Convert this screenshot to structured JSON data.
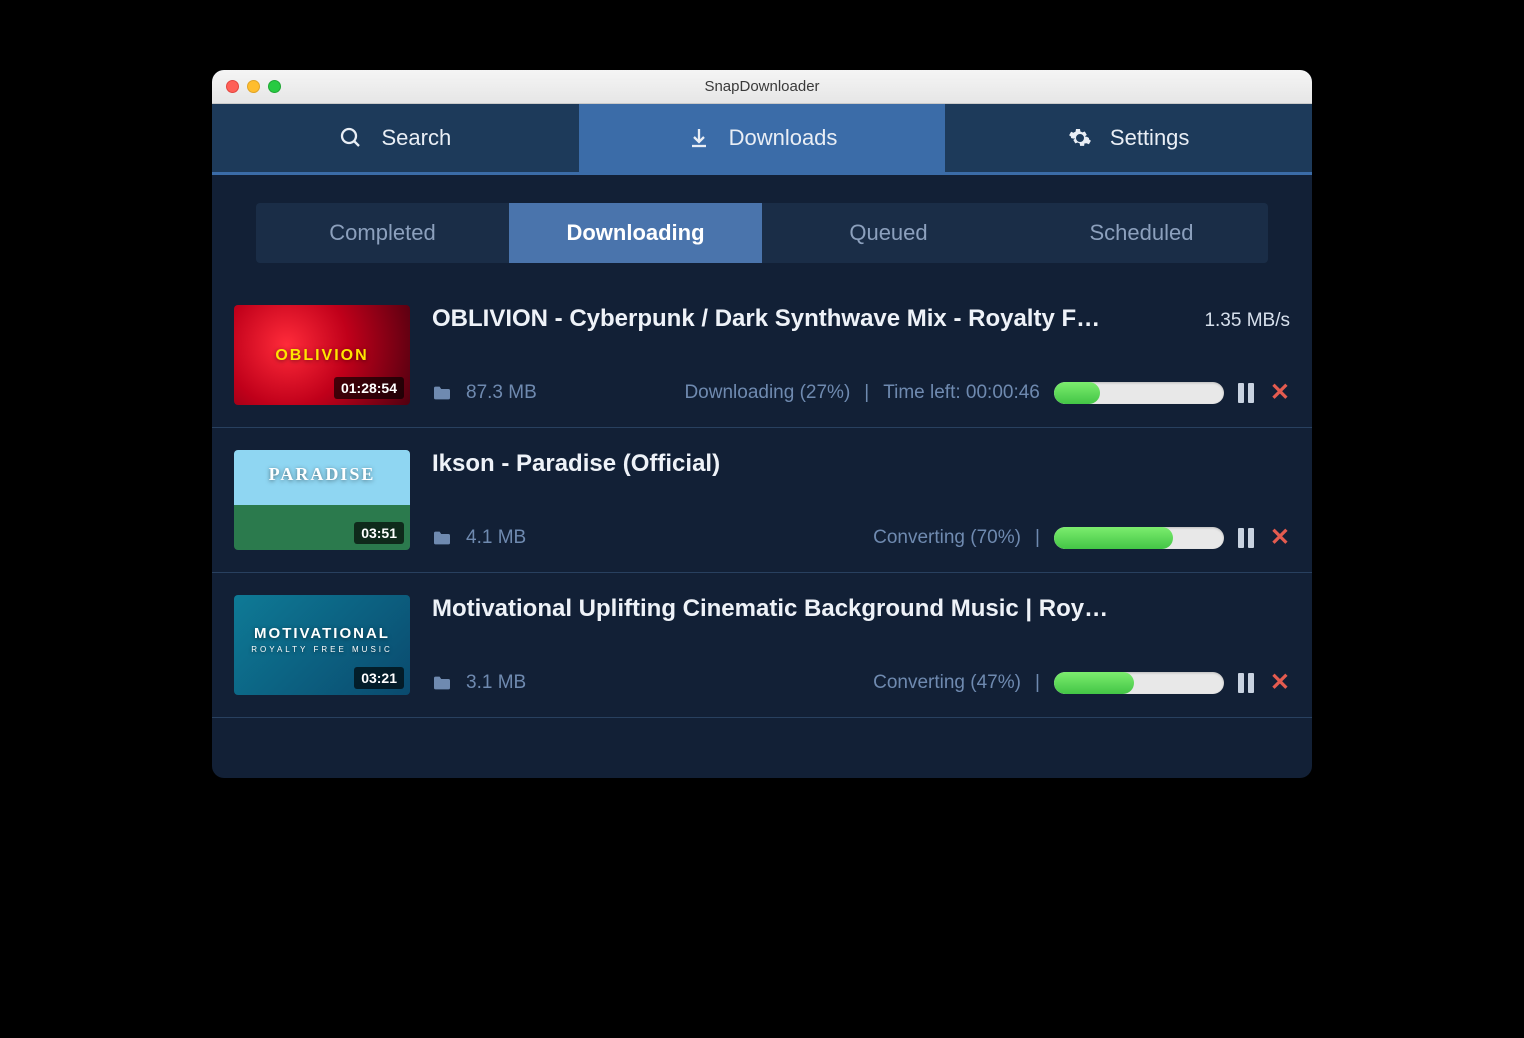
{
  "window": {
    "title": "SnapDownloader"
  },
  "main_tabs": {
    "search": "Search",
    "downloads": "Downloads",
    "settings": "Settings"
  },
  "sub_tabs": {
    "completed": "Completed",
    "downloading": "Downloading",
    "queued": "Queued",
    "scheduled": "Scheduled"
  },
  "items": [
    {
      "title": "OBLIVION - Cyberpunk / Dark Synthwave Mix - Royalty F…",
      "duration": "01:28:54",
      "thumb_label": "OBLIVION",
      "size": "87.3 MB",
      "status": "Downloading (27%)",
      "time_left": "Time left: 00:00:46",
      "speed": "1.35 MB/s",
      "progress_pct": 27
    },
    {
      "title": "Ikson - Paradise (Official)",
      "duration": "03:51",
      "thumb_label": "PARADISE",
      "size": "4.1 MB",
      "status": "Converting (70%)",
      "time_left": "",
      "speed": "",
      "progress_pct": 70
    },
    {
      "title": "Motivational Uplifting Cinematic Background Music | Roy…",
      "duration": "03:21",
      "thumb_label": "MOTIVATIONAL",
      "thumb_sub": "ROYALTY FREE MUSIC",
      "size": "3.1 MB",
      "status": "Converting (47%)",
      "time_left": "",
      "speed": "",
      "progress_pct": 47
    }
  ]
}
